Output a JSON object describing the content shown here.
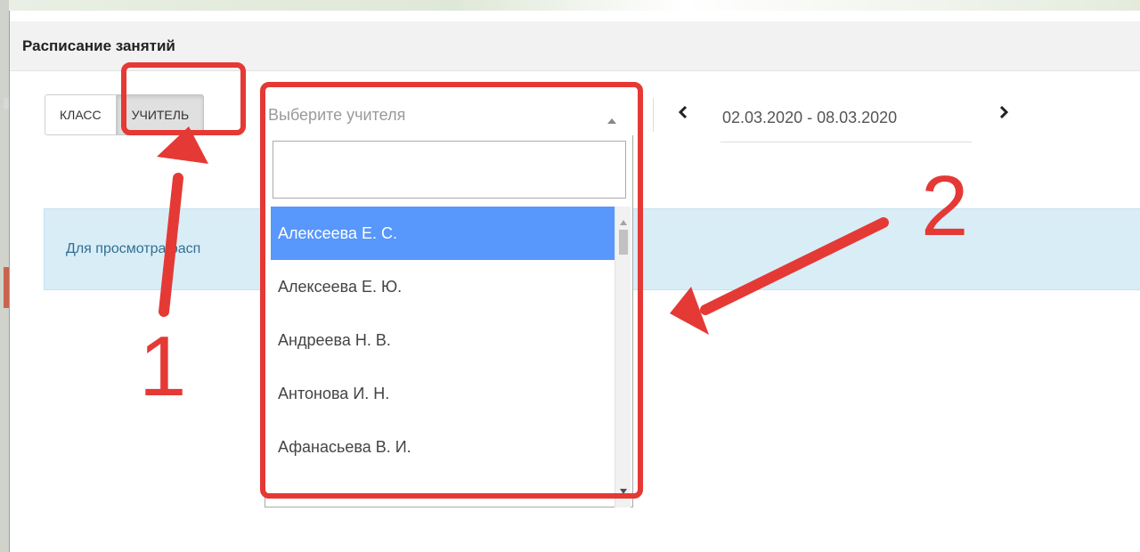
{
  "modal": {
    "title": "Расписание занятий"
  },
  "mode_buttons": {
    "class_label": "КЛАСС",
    "teacher_label": "УЧИТЕЛЬ"
  },
  "teacher_select": {
    "placeholder": "Выберите учителя",
    "search_value": "",
    "options": [
      "Алексеева Е. С.",
      "Алексеева Е. Ю.",
      "Андреева Н. В.",
      "Антонова И. Н.",
      "Афанасьева В. И."
    ],
    "highlighted_index": 0
  },
  "week_nav": {
    "date_range": "02.03.2020 - 08.03.2020",
    "prev_icon": "chevron-left-icon",
    "next_icon": "chevron-right-icon"
  },
  "info_alert": {
    "text": "Для просмотра расп"
  },
  "annotations": {
    "label_1": "1",
    "label_2": "2",
    "color": "#e53935"
  },
  "colors": {
    "highlight": "#5897fb",
    "alert_bg": "#d9edf7",
    "alert_text": "#31708f"
  }
}
